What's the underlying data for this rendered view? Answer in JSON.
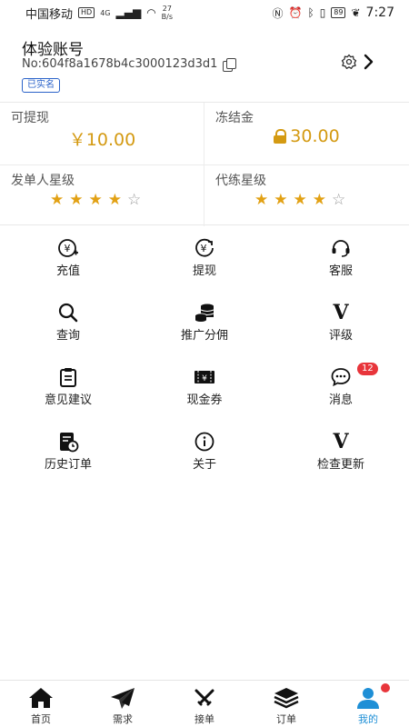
{
  "status_bar": {
    "carrier": "中国移动",
    "hd": "HD",
    "network": "4G",
    "speed_value": "27",
    "speed_unit": "B/s",
    "battery": "89",
    "time": "7:27"
  },
  "profile": {
    "name": "体验账号",
    "account_id": "No:604f8a1678b4c3000123d3d1",
    "verified": "已实名"
  },
  "wallet": {
    "withdrawable_label": "可提现",
    "withdrawable_amount": "￥10.00",
    "frozen_label": "冻结金",
    "frozen_amount": "30.00",
    "publisher_rating_label": "发单人星级",
    "publisher_stars": 4,
    "booster_rating_label": "代练星级",
    "booster_stars": 4,
    "max_stars": 5
  },
  "menu": {
    "recharge": "充值",
    "withdraw": "提现",
    "service": "客服",
    "query": "查询",
    "referral": "推广分佣",
    "rating": "评级",
    "feedback": "意见建议",
    "coupon": "现金券",
    "messages": "消息",
    "messages_badge": "12",
    "history": "历史订单",
    "about": "关于",
    "update": "检查更新"
  },
  "tabs": {
    "home": "首页",
    "demand": "需求",
    "accept": "接单",
    "orders": "订单",
    "mine": "我的"
  },
  "colors": {
    "accent": "#1e8fd6",
    "money": "#d49a12",
    "star": "#e2a114",
    "badge": "#e8353b",
    "verified": "#2a62c9"
  }
}
